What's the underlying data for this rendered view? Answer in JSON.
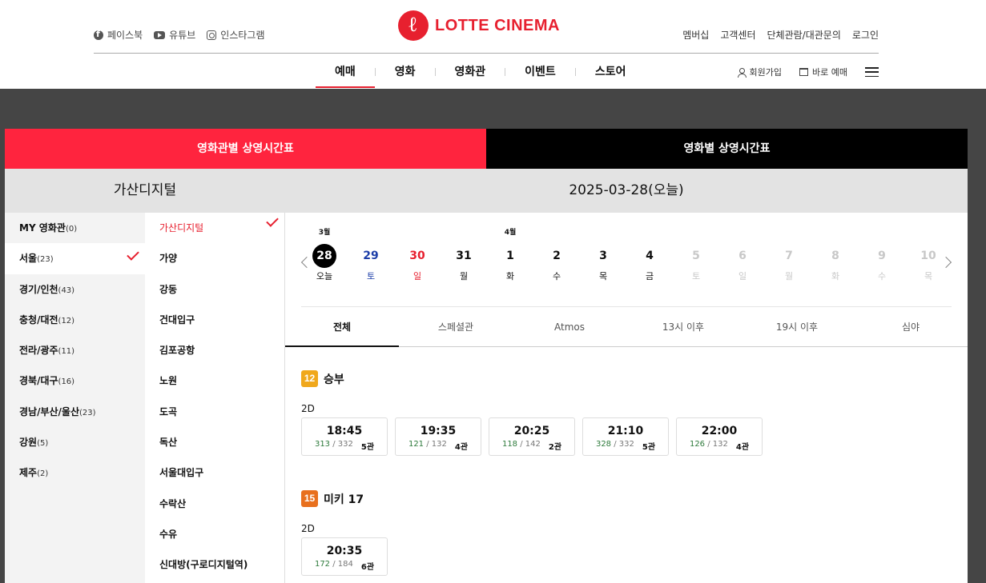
{
  "header": {
    "sns": [
      {
        "icon": "facebook-icon",
        "label": "페이스북"
      },
      {
        "icon": "youtube-icon",
        "label": "유튜브"
      },
      {
        "icon": "instagram-icon",
        "label": "인스타그램"
      }
    ],
    "logo_text": "LOTTE CINEMA",
    "util_links": [
      "멤버십",
      "고객센터",
      "단체관람/대관문의",
      "로그인"
    ],
    "gnb": [
      "예매",
      "영화",
      "영화관",
      "이벤트",
      "스토어"
    ],
    "gnb_active": "예매",
    "signup_label": "회원가입",
    "quick_booking_label": "바로 예매",
    "accent_color": "#e7202f"
  },
  "tabs": {
    "by_theater": "영화관별 상영시간표",
    "by_movie": "영화별 상영시간표"
  },
  "left": {
    "selected_theater": "가산디지털",
    "regions": [
      {
        "name": "MY 영화관",
        "count": "(0)"
      },
      {
        "name": "서울",
        "count": "(23)"
      },
      {
        "name": "경기/인천",
        "count": "(43)"
      },
      {
        "name": "충청/대전",
        "count": "(12)"
      },
      {
        "name": "전라/광주",
        "count": "(11)"
      },
      {
        "name": "경북/대구",
        "count": "(16)"
      },
      {
        "name": "경남/부산/울산",
        "count": "(23)"
      },
      {
        "name": "강원",
        "count": "(5)"
      },
      {
        "name": "제주",
        "count": "(2)"
      }
    ],
    "theaters": [
      "가산디지털",
      "가양",
      "강동",
      "건대입구",
      "김포공항",
      "노원",
      "도곡",
      "독산",
      "서울대입구",
      "수락산",
      "수유",
      "신대방(구로디지털역)"
    ]
  },
  "right": {
    "selected_date": "2025-03-28(오늘)",
    "dates": [
      {
        "month": "3월",
        "day": "28",
        "dow": "오늘",
        "kind": "sel"
      },
      {
        "month": "",
        "day": "29",
        "dow": "토",
        "kind": "sat"
      },
      {
        "month": "",
        "day": "30",
        "dow": "일",
        "kind": "sun"
      },
      {
        "month": "",
        "day": "31",
        "dow": "월",
        "kind": ""
      },
      {
        "month": "4월",
        "day": "1",
        "dow": "화",
        "kind": ""
      },
      {
        "month": "",
        "day": "2",
        "dow": "수",
        "kind": ""
      },
      {
        "month": "",
        "day": "3",
        "dow": "목",
        "kind": ""
      },
      {
        "month": "",
        "day": "4",
        "dow": "금",
        "kind": ""
      },
      {
        "month": "",
        "day": "5",
        "dow": "토",
        "kind": "dis"
      },
      {
        "month": "",
        "day": "6",
        "dow": "일",
        "kind": "dis"
      },
      {
        "month": "",
        "day": "7",
        "dow": "월",
        "kind": "dis"
      },
      {
        "month": "",
        "day": "8",
        "dow": "화",
        "kind": "dis"
      },
      {
        "month": "",
        "day": "9",
        "dow": "수",
        "kind": "dis"
      },
      {
        "month": "",
        "day": "10",
        "dow": "목",
        "kind": "dis"
      }
    ],
    "filters": [
      "전체",
      "스페셜관",
      "Atmos",
      "13시 이후",
      "19시 이후",
      "심야"
    ],
    "movies": [
      {
        "rating": "12",
        "rating_color": "#f0a81c",
        "title": "승부",
        "format": "2D",
        "showtimes": [
          {
            "time": "18:45",
            "remain": "313",
            "total": "/ 332",
            "hall": "5관"
          },
          {
            "time": "19:35",
            "remain": "121",
            "total": "/ 132",
            "hall": "4관"
          },
          {
            "time": "20:25",
            "remain": "118",
            "total": "/ 142",
            "hall": "2관"
          },
          {
            "time": "21:10",
            "remain": "328",
            "total": "/ 332",
            "hall": "5관"
          },
          {
            "time": "22:00",
            "remain": "126",
            "total": "/ 132",
            "hall": "4관"
          }
        ]
      },
      {
        "rating": "15",
        "rating_color": "#e8701e",
        "title": "미키 17",
        "format": "2D",
        "showtimes": [
          {
            "time": "20:35",
            "remain": "172",
            "total": "/ 184",
            "hall": "6관"
          }
        ]
      }
    ]
  }
}
